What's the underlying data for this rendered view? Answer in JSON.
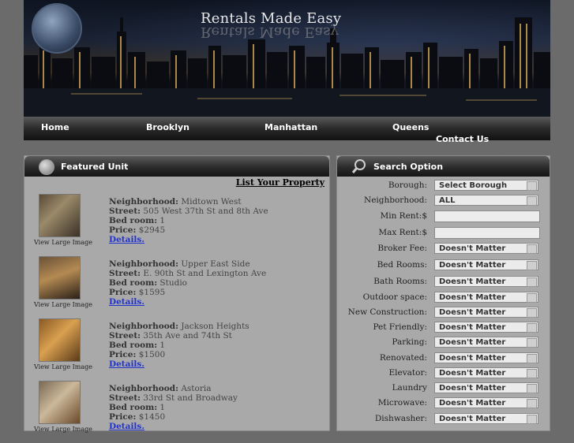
{
  "site": {
    "title": "Rentals Made Easy"
  },
  "nav": {
    "items": [
      "Home",
      "Brooklyn",
      "Manhattan",
      "Queens",
      "Contact Us"
    ]
  },
  "featured": {
    "title": "Featured Unit",
    "list_link": "List Your Property",
    "labels": {
      "neighborhood": "Neighborhood:",
      "street": "Street:",
      "bedroom": "Bed room:",
      "price": "Price:",
      "details": "Details.",
      "thumb_caption": "View Large Image"
    },
    "units": [
      {
        "neighborhood": "Midtown West",
        "street": "505 West 37th St and 8th Ave",
        "bedroom": "1",
        "price": "$2945"
      },
      {
        "neighborhood": "Upper East Side",
        "street": "E. 90th St and Lexington Ave",
        "bedroom": "Studio",
        "price": "$1595"
      },
      {
        "neighborhood": "Jackson Heights",
        "street": "35th Ave and 74th St",
        "bedroom": "1",
        "price": "$1500"
      },
      {
        "neighborhood": "Astoria",
        "street": "33rd St and Broadway",
        "bedroom": "1",
        "price": "$1450"
      }
    ]
  },
  "search": {
    "title": "Search Option",
    "fields": [
      {
        "label": "Borough:",
        "type": "select",
        "value": "Select Borough"
      },
      {
        "label": "Neighborhood:",
        "type": "select",
        "value": "ALL"
      },
      {
        "label": "Min Rent:$",
        "type": "text",
        "value": ""
      },
      {
        "label": "Max Rent:$",
        "type": "text",
        "value": ""
      },
      {
        "label": "Broker Fee:",
        "type": "select",
        "value": "Doesn't Matter"
      },
      {
        "label": "Bed Rooms:",
        "type": "select",
        "value": "Doesn't Matter"
      },
      {
        "label": "Bath Rooms:",
        "type": "select",
        "value": "Doesn't Matter"
      },
      {
        "label": "Outdoor space:",
        "type": "select",
        "value": "Doesn't Matter"
      },
      {
        "label": "New Construction:",
        "type": "select",
        "value": "Doesn't Matter"
      },
      {
        "label": "Pet Friendly:",
        "type": "select",
        "value": "Doesn't Matter"
      },
      {
        "label": "Parking:",
        "type": "select",
        "value": "Doesn't Matter"
      },
      {
        "label": "Renovated:",
        "type": "select",
        "value": "Doesn't Matter"
      },
      {
        "label": "Elevator:",
        "type": "select",
        "value": "Doesn't Matter"
      },
      {
        "label": "Laundry",
        "type": "select",
        "value": "Doesn't Matter"
      },
      {
        "label": "Microwave:",
        "type": "select",
        "value": "Doesn't Matter"
      },
      {
        "label": "Dishwasher:",
        "type": "select",
        "value": "Doesn't Matter"
      }
    ]
  }
}
